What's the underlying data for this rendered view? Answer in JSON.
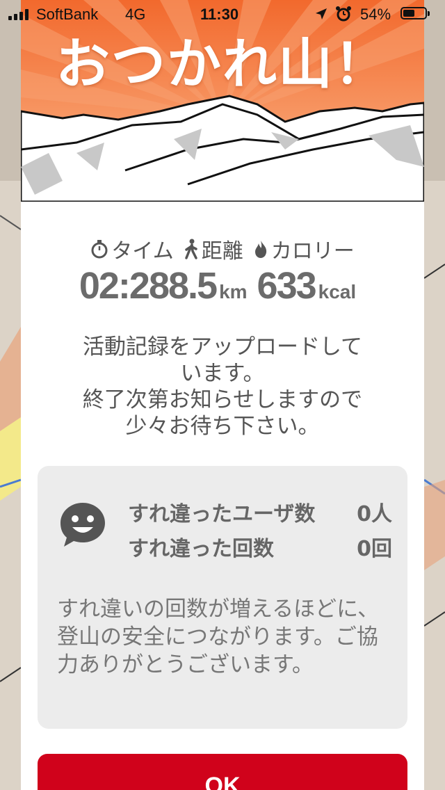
{
  "status_bar": {
    "carrier": "SoftBank",
    "network": "4G",
    "time": "11:30",
    "battery_percent": "54%",
    "battery_level": 0.54
  },
  "hero": {
    "title": "おつかれ山！",
    "colors": {
      "orange_top": "#f2692d",
      "orange_bottom": "#fbb88b"
    }
  },
  "stats": {
    "labels": {
      "time": "タイム",
      "distance": "距離",
      "calories": "カロリー"
    },
    "time_value": "02:28",
    "distance_value": "8.5",
    "distance_unit": "km",
    "calories_value": "633",
    "calories_unit": "kcal"
  },
  "upload_message": {
    "line1": "活動記録をアップロードして",
    "line2": "います。",
    "line3": "終了次第お知らせしますので",
    "line4": "少々お待ち下さい。"
  },
  "encounters": {
    "users_label": "すれ違ったユーザ数",
    "users_value": "0人",
    "count_label": "すれ違った回数",
    "count_value": "0回",
    "note": "すれ違いの回数が増えるほどに、登山の安全につながります。ご協力ありがとうございます。"
  },
  "ok_button": {
    "label": "OK",
    "color": "#d0021b"
  }
}
